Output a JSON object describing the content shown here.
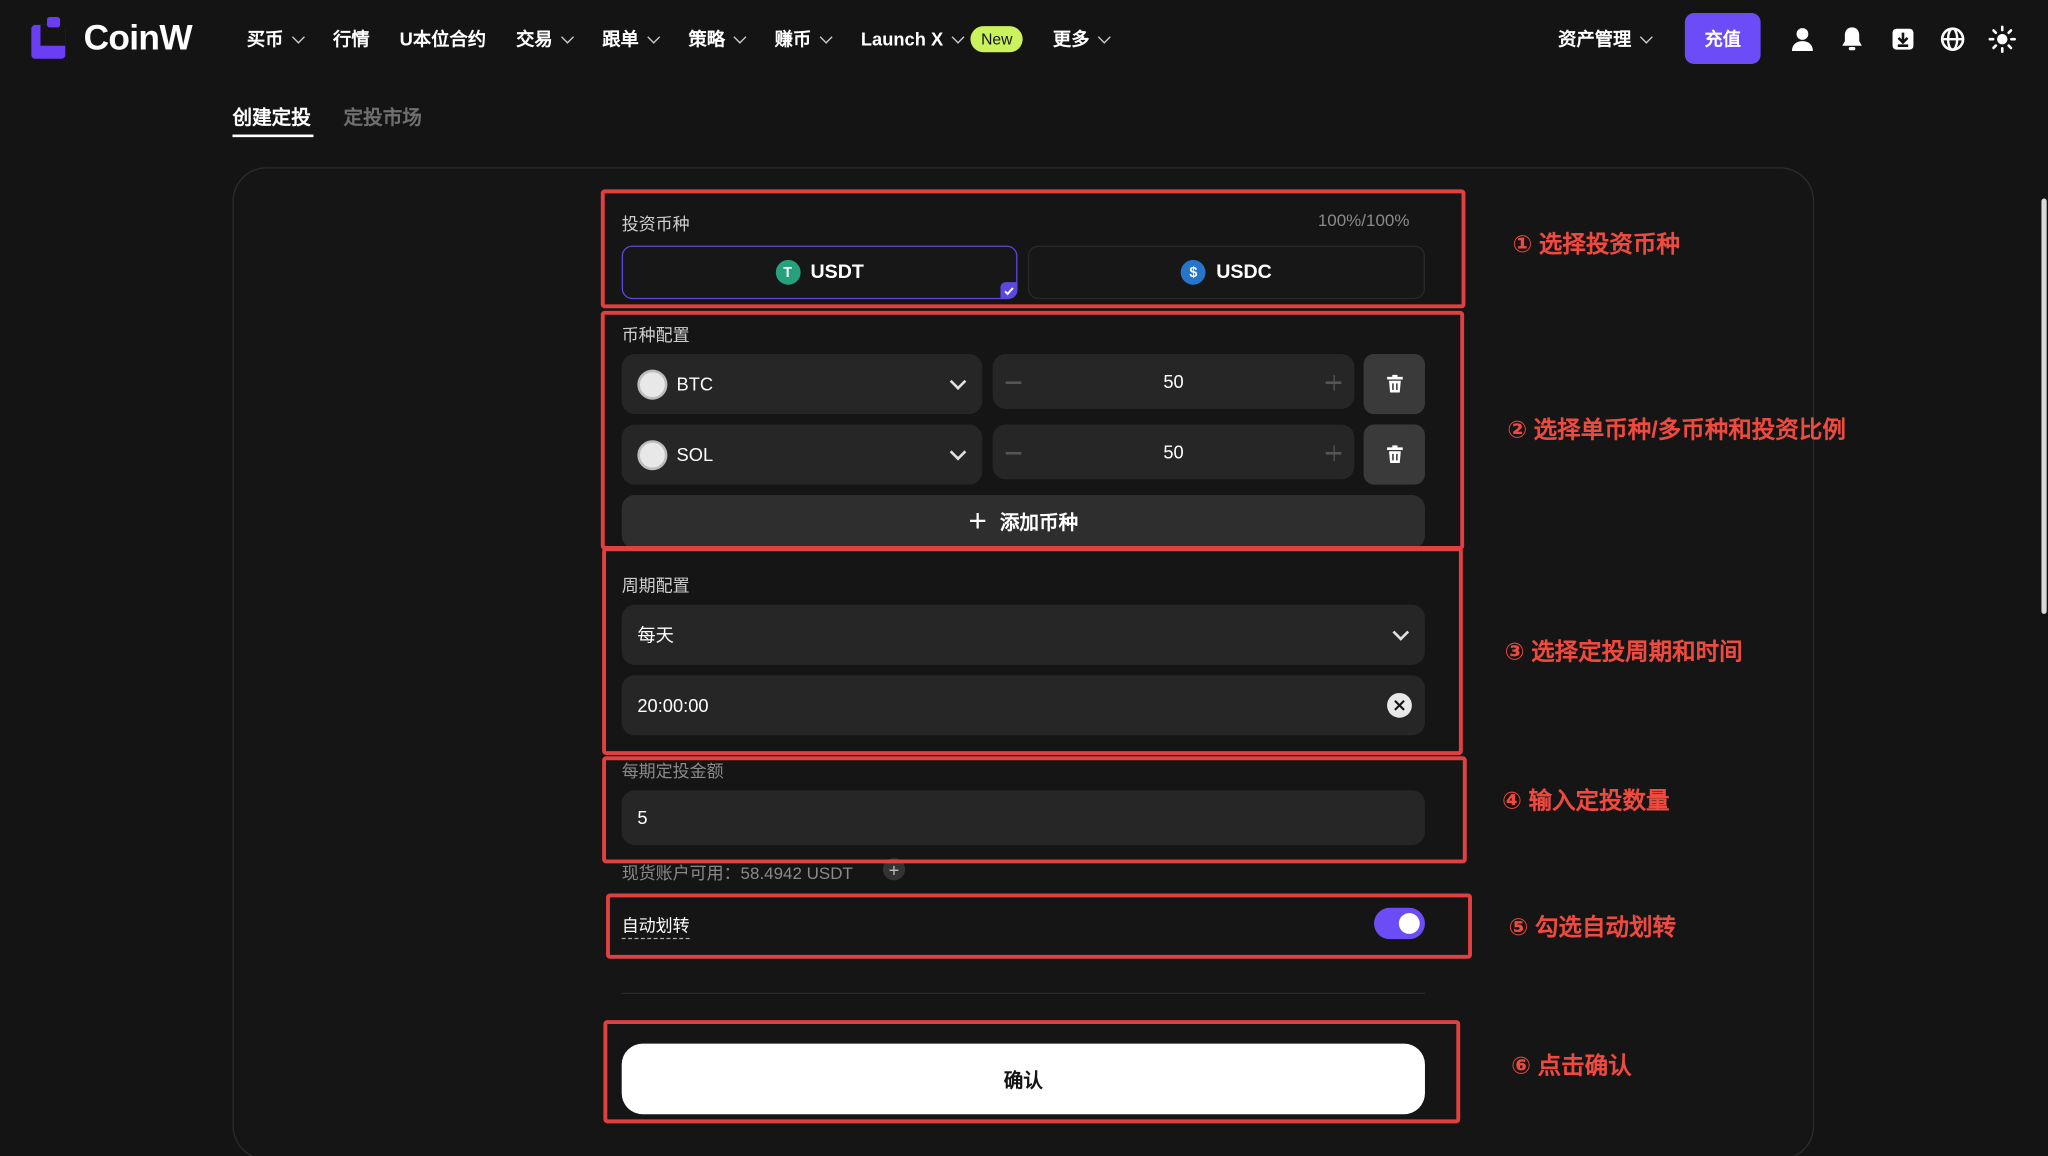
{
  "brand": {
    "name": "CoinW",
    "accent": "#6b4cf6"
  },
  "nav": {
    "items": [
      {
        "label": "买币",
        "dropdown": true
      },
      {
        "label": "行情",
        "dropdown": false
      },
      {
        "label": "U本位合约",
        "dropdown": false
      },
      {
        "label": "交易",
        "dropdown": true
      },
      {
        "label": "跟单",
        "dropdown": true
      },
      {
        "label": "策略",
        "dropdown": true
      },
      {
        "label": "赚币",
        "dropdown": true
      },
      {
        "label": "Launch X",
        "dropdown": true,
        "badge": "New"
      },
      {
        "label": "更多",
        "dropdown": true
      }
    ],
    "asset_menu": "资产管理",
    "deposit_button": "充值",
    "icons": [
      "user-icon",
      "bell-icon",
      "download-icon",
      "globe-icon",
      "sun-icon"
    ]
  },
  "tabs": {
    "create": "创建定投",
    "market": "定投市场"
  },
  "form": {
    "invest_coin": {
      "label": "投资币种",
      "ratio": "100%/100%",
      "options": [
        {
          "symbol": "USDT",
          "color": "#26a17b",
          "glyph": "T",
          "selected": true
        },
        {
          "symbol": "USDC",
          "color": "#2775ca",
          "glyph": "$",
          "selected": false
        }
      ]
    },
    "coin_config": {
      "label": "币种配置",
      "rows": [
        {
          "coin": "BTC",
          "percent": "50"
        },
        {
          "coin": "SOL",
          "percent": "50"
        }
      ],
      "add_label": "添加币种"
    },
    "period": {
      "label": "周期配置",
      "frequency": "每天",
      "time": "20:00:00"
    },
    "amount": {
      "label": "每期定投金额",
      "value": "5",
      "available": "现货账户可用：58.4942 USDT"
    },
    "auto_transfer": {
      "label": "自动划转",
      "enabled": true
    },
    "confirm": "确认"
  },
  "annotations": [
    "① 选择投资币种",
    "② 选择单币种/多币种和投资比例",
    "③ 选择定投周期和时间",
    "④ 输入定投数量",
    "⑤ 勾选自动划转",
    "⑥ 点击确认"
  ],
  "annotation_color": "#e0403f"
}
